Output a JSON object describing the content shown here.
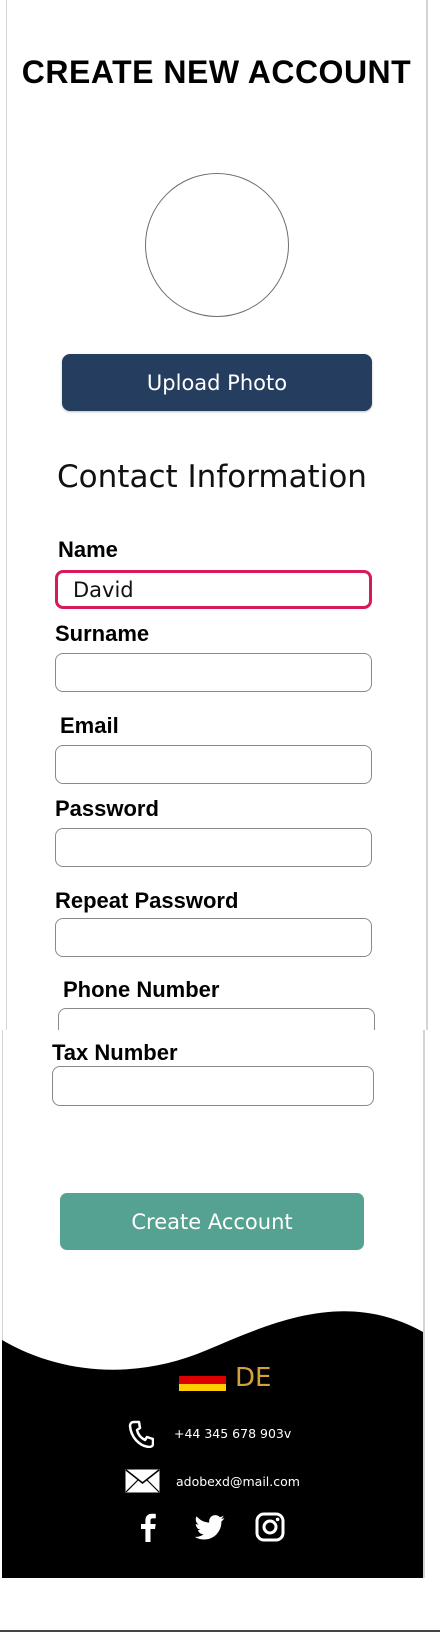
{
  "page": {
    "title": "CREATE NEW ACCOUNT"
  },
  "upload_button": {
    "label": "Upload Photo"
  },
  "contact": {
    "heading": "Contact Information",
    "fields": {
      "name": {
        "label": "Name",
        "value": "David"
      },
      "surname": {
        "label": "Surname",
        "value": ""
      },
      "email": {
        "label": "Email",
        "value": ""
      },
      "password": {
        "label": "Password",
        "value": ""
      },
      "repeat_password": {
        "label": "Repeat Password",
        "value": ""
      },
      "phone": {
        "label": "Phone Number",
        "value": ""
      },
      "tax": {
        "label": "Tax Number",
        "value": ""
      }
    }
  },
  "create_button": {
    "label": "Create Account"
  },
  "footer": {
    "language": {
      "code": "DE",
      "flag_colors": [
        "#000000",
        "#dd0000",
        "#ffce00"
      ]
    },
    "phone": "+44 345 678 903v",
    "email": "adobexd@mail.com",
    "social": [
      "facebook-icon",
      "twitter-icon",
      "instagram-icon"
    ]
  },
  "colors": {
    "upload_button": "#253d5e",
    "create_button": "#55a192",
    "active_field_border": "#d8195c",
    "language_text": "#d1a23b",
    "footer_background": "#000000"
  }
}
